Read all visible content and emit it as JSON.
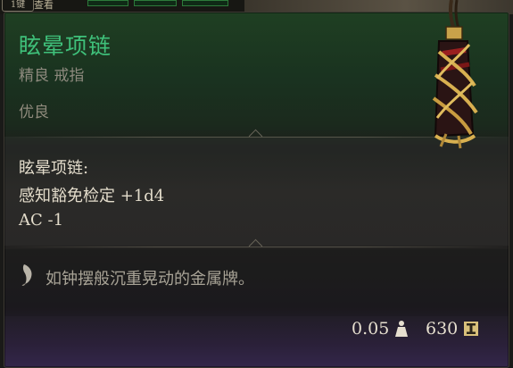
{
  "hud": {
    "keycap_label": "1键",
    "label": "查看"
  },
  "item": {
    "name": "眩晕项链",
    "type": "精良 戒指",
    "rarity": "优良",
    "name_color": "#3fc07a"
  },
  "effects": {
    "title": "眩晕项链:",
    "lines": [
      "感知豁免检定 +1d4",
      "AC -1"
    ]
  },
  "description": {
    "icon": "quill-icon",
    "text": "如钟摆般沉重晃动的金属牌。"
  },
  "footer": {
    "weight": "0.05",
    "weight_icon": "weight-icon",
    "price": "630",
    "price_icon": "gold-coin-icon"
  }
}
